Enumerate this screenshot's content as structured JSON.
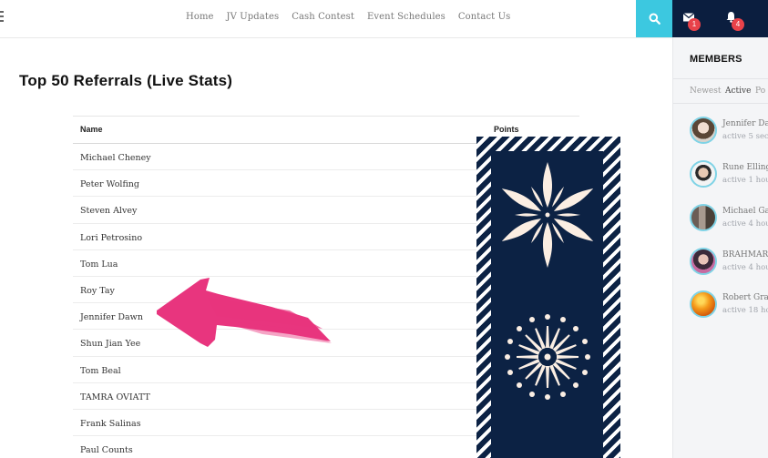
{
  "nav": {
    "items": [
      "Home",
      "JV Updates",
      "Cash Contest",
      "Event Schedules",
      "Contact Us"
    ]
  },
  "header": {
    "messages_badge": "1",
    "notifications_badge": "4"
  },
  "colors": {
    "search_accent": "#3cc8e0",
    "dark_navy": "#0b1e3f",
    "badge_red": "#e8424a",
    "arrow_pink": "#e8357e"
  },
  "main": {
    "title": "Top 50 Referrals (Live Stats)",
    "table": {
      "columns": [
        "Name",
        "Points"
      ],
      "rows": [
        "Michael Cheney",
        "Peter Wolfing",
        "Steven Alvey",
        "Lori Petrosino",
        "Tom Lua",
        "Roy Tay",
        "Jennifer Dawn",
        "Shun Jian Yee",
        "Tom Beal",
        "TAMRA OVIATT",
        "Frank Salinas",
        "Paul Counts"
      ]
    }
  },
  "sidebar": {
    "title": "MEMBERS",
    "tabs": [
      "Newest",
      "Active",
      "Po"
    ],
    "active_tab": "Active",
    "members": [
      {
        "name": "Jennifer Da",
        "activity": "active 5 sec"
      },
      {
        "name": "Rune Elling",
        "activity": "active 1 hou"
      },
      {
        "name": "Michael Ga",
        "activity": "active 4 hou"
      },
      {
        "name": "BRAHMAR",
        "activity": "active 4 hou"
      },
      {
        "name": "Robert Gra",
        "activity": "active 18 ho"
      }
    ]
  }
}
